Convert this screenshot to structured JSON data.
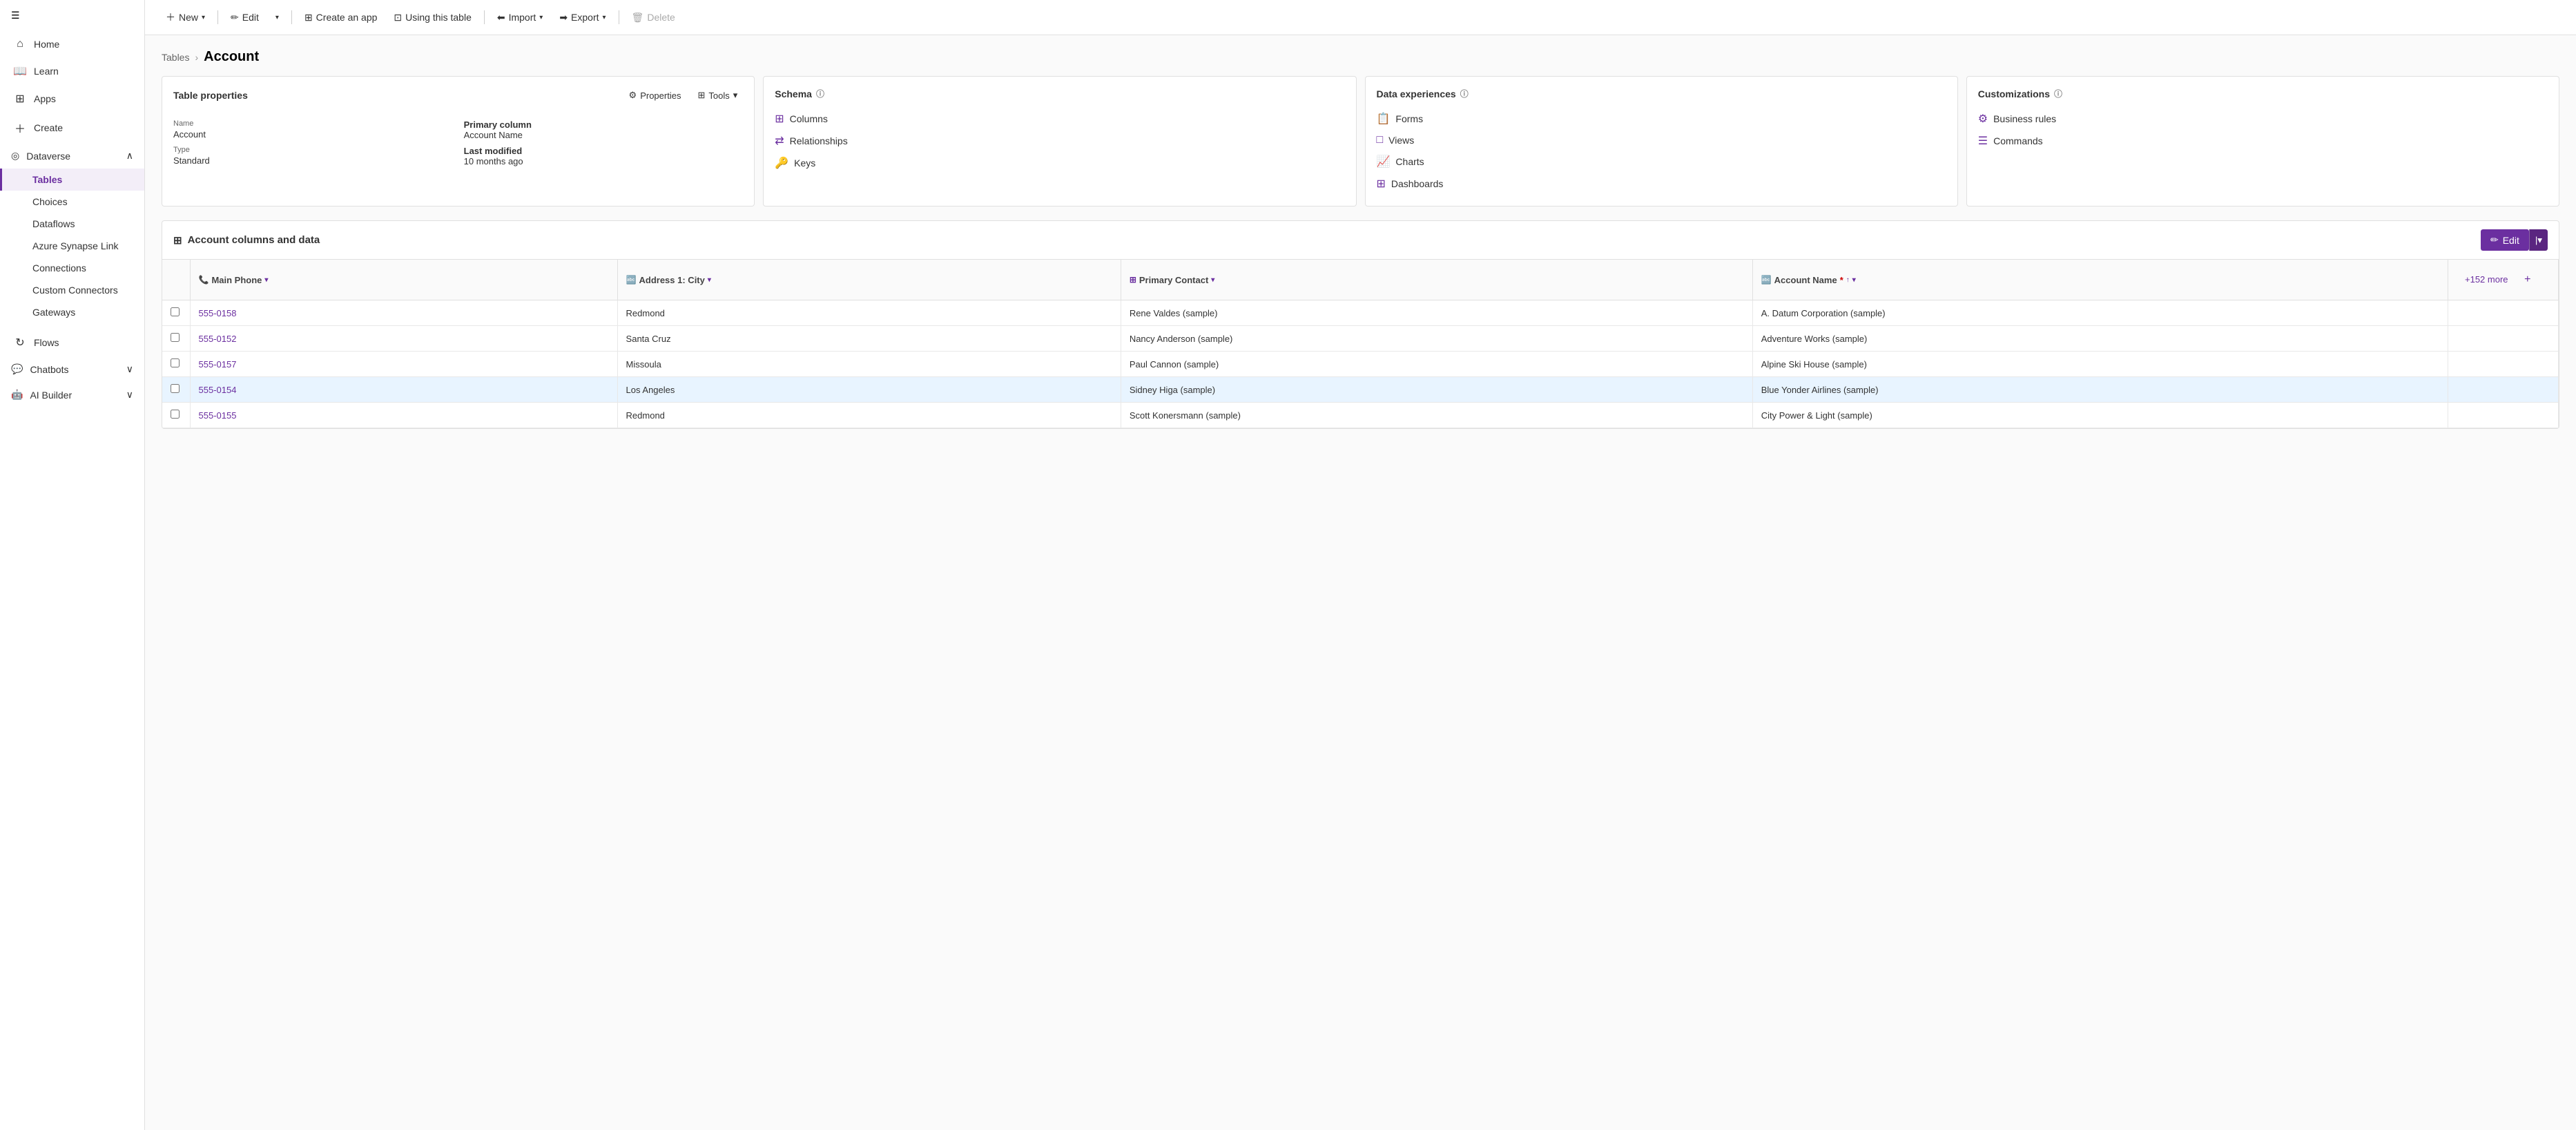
{
  "sidebar": {
    "hamburger_icon": "☰",
    "items": [
      {
        "id": "home",
        "label": "Home",
        "icon": "⌂",
        "active": false
      },
      {
        "id": "learn",
        "label": "Learn",
        "icon": "📖",
        "active": false
      },
      {
        "id": "apps",
        "label": "Apps",
        "icon": "⊞",
        "active": false
      },
      {
        "id": "create",
        "label": "Create",
        "icon": "+",
        "active": false
      },
      {
        "id": "dataverse",
        "label": "Dataverse",
        "icon": "◎",
        "expanded": true,
        "active": false
      }
    ],
    "sub_items": [
      {
        "id": "tables",
        "label": "Tables",
        "active": true
      },
      {
        "id": "choices",
        "label": "Choices",
        "active": false
      },
      {
        "id": "dataflows",
        "label": "Dataflows",
        "active": false
      },
      {
        "id": "azure_synapse",
        "label": "Azure Synapse Link",
        "active": false
      },
      {
        "id": "connections",
        "label": "Connections",
        "active": false
      },
      {
        "id": "custom_connectors",
        "label": "Custom Connectors",
        "active": false
      },
      {
        "id": "gateways",
        "label": "Gateways",
        "active": false
      }
    ],
    "bottom_items": [
      {
        "id": "flows",
        "label": "Flows",
        "icon": "↻",
        "active": false
      },
      {
        "id": "chatbots",
        "label": "Chatbots",
        "icon": "💬",
        "active": false,
        "expandable": true
      },
      {
        "id": "ai_builder",
        "label": "AI Builder",
        "icon": "🤖",
        "active": false,
        "expandable": true
      }
    ]
  },
  "toolbar": {
    "new_label": "New",
    "edit_label": "Edit",
    "create_app_label": "Create an app",
    "using_table_label": "Using this table",
    "import_label": "Import",
    "export_label": "Export",
    "delete_label": "Delete"
  },
  "breadcrumb": {
    "parent": "Tables",
    "separator": "›",
    "current": "Account"
  },
  "table_properties_card": {
    "title": "Table properties",
    "properties_label": "Properties",
    "tools_label": "Tools",
    "name_label": "Name",
    "name_value": "Account",
    "type_label": "Type",
    "type_value": "Standard",
    "primary_column_label": "Primary column",
    "primary_column_value": "Account Name",
    "last_modified_label": "Last modified",
    "last_modified_value": "10 months ago"
  },
  "schema_card": {
    "title": "Schema",
    "info_icon": "ⓘ",
    "links": [
      {
        "id": "columns",
        "label": "Columns",
        "icon": "⊞"
      },
      {
        "id": "relationships",
        "label": "Relationships",
        "icon": "⇄"
      },
      {
        "id": "keys",
        "label": "Keys",
        "icon": "🔑"
      }
    ]
  },
  "data_experiences_card": {
    "title": "Data experiences",
    "info_icon": "ⓘ",
    "links": [
      {
        "id": "forms",
        "label": "Forms",
        "icon": "📋"
      },
      {
        "id": "views",
        "label": "Views",
        "icon": "□"
      },
      {
        "id": "charts",
        "label": "Charts",
        "icon": "📈"
      },
      {
        "id": "dashboards",
        "label": "Dashboards",
        "icon": "⊞"
      }
    ]
  },
  "customizations_card": {
    "title": "Customizations",
    "info_icon": "ⓘ",
    "links": [
      {
        "id": "business_rules",
        "label": "Business rules",
        "icon": "⚙"
      },
      {
        "id": "commands",
        "label": "Commands",
        "icon": "☰"
      }
    ]
  },
  "data_table": {
    "section_title": "Account columns and data",
    "edit_label": "Edit",
    "columns": [
      {
        "id": "main_phone",
        "label": "Main Phone",
        "icon": "📞",
        "sortable": true
      },
      {
        "id": "address_city",
        "label": "Address 1: City",
        "icon": "🔤",
        "sortable": true
      },
      {
        "id": "primary_contact",
        "label": "Primary Contact",
        "icon": "⊞",
        "sortable": true
      },
      {
        "id": "account_name",
        "label": "Account Name",
        "icon": "🔤",
        "required": true,
        "sorted": true,
        "sort_dir": "asc"
      }
    ],
    "more_cols_label": "+152 more",
    "add_col_icon": "+",
    "rows": [
      {
        "id": 1,
        "main_phone": "555-0158",
        "address_city": "Redmond",
        "primary_contact": "Rene Valdes (sample)",
        "account_name": "A. Datum Corporation (sample)",
        "highlighted": false
      },
      {
        "id": 2,
        "main_phone": "555-0152",
        "address_city": "Santa Cruz",
        "primary_contact": "Nancy Anderson (sample)",
        "account_name": "Adventure Works (sample)",
        "highlighted": false
      },
      {
        "id": 3,
        "main_phone": "555-0157",
        "address_city": "Missoula",
        "primary_contact": "Paul Cannon (sample)",
        "account_name": "Alpine Ski House (sample)",
        "highlighted": false
      },
      {
        "id": 4,
        "main_phone": "555-0154",
        "address_city": "Los Angeles",
        "primary_contact": "Sidney Higa (sample)",
        "account_name": "Blue Yonder Airlines (sample)",
        "highlighted": true
      },
      {
        "id": 5,
        "main_phone": "555-0155",
        "address_city": "Redmond",
        "primary_contact": "Scott Konersmann (sample)",
        "account_name": "City Power & Light (sample)",
        "highlighted": false
      }
    ]
  }
}
